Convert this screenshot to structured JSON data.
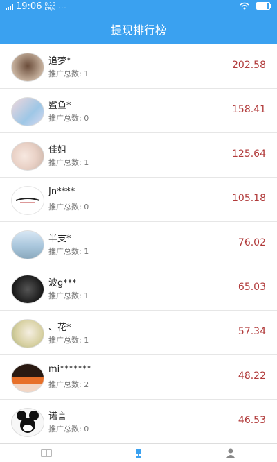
{
  "status_bar": {
    "time": "19:06",
    "network_speed": "0.10",
    "network_unit": "KB/s",
    "more": "..."
  },
  "header": {
    "title": "提现排行榜"
  },
  "colors": {
    "header_bg": "#3aa1f0",
    "amount": "#b13a3a"
  },
  "rows": [
    {
      "name": "追梦*",
      "promo_label": "推广总数:",
      "promo_count": "1",
      "amount": "202.58"
    },
    {
      "name": "鲨鱼*",
      "promo_label": "推广总数:",
      "promo_count": "0",
      "amount": "158.41"
    },
    {
      "name": "佳姐",
      "promo_label": "推广总数:",
      "promo_count": "1",
      "amount": "125.64"
    },
    {
      "name": "Jn****",
      "promo_label": "推广总数:",
      "promo_count": "0",
      "amount": "105.18"
    },
    {
      "name": "半支*",
      "promo_label": "推广总数:",
      "promo_count": "1",
      "amount": "76.02"
    },
    {
      "name": "波g***",
      "promo_label": "推广总数:",
      "promo_count": "1",
      "amount": "65.03"
    },
    {
      "name": "、花*",
      "promo_label": "推广总数:",
      "promo_count": "1",
      "amount": "57.34"
    },
    {
      "name": "mi*******",
      "promo_label": "推广总数:",
      "promo_count": "2",
      "amount": "48.22"
    },
    {
      "name": "诺言",
      "promo_label": "推广总数:",
      "promo_count": "0",
      "amount": "46.53"
    }
  ],
  "tabs": [
    {
      "icon": "book-icon"
    },
    {
      "icon": "trophy-icon"
    },
    {
      "icon": "user-icon"
    }
  ]
}
